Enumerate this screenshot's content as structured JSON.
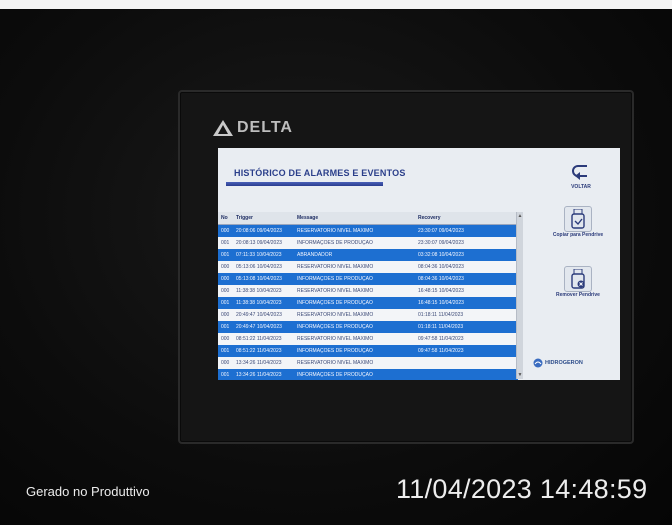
{
  "device": {
    "brand": "DELTA"
  },
  "screen": {
    "title": "HISTÓRICO DE ALARMES E EVENTOS",
    "table": {
      "headers": [
        "No",
        "Trigger",
        "Message",
        "Recovery"
      ],
      "rows": [
        {
          "no": "000",
          "trigger": "20:08:06 09/04/2023",
          "message": "RESERVATÓRIO NÍVEL MÁXIMO",
          "recovery": "23:30:07 09/04/2023",
          "style": "blue"
        },
        {
          "no": "001",
          "trigger": "20:08:13 09/04/2023",
          "message": "INFORMAÇÕES DE PRODUÇÃO",
          "recovery": "23:30:07 09/04/2023",
          "style": "white"
        },
        {
          "no": "001",
          "trigger": "07:11:33 10/04/2023",
          "message": "ABRANDADOR",
          "recovery": "03:32:08 10/04/2023",
          "style": "blue"
        },
        {
          "no": "000",
          "trigger": "05:13:06 10/04/2023",
          "message": "RESERVATÓRIO NÍVEL MÁXIMO",
          "recovery": "08:04:36 10/04/2023",
          "style": "white"
        },
        {
          "no": "000",
          "trigger": "05:13:08 10/04/2023",
          "message": "INFORMAÇÕES DE PRODUÇÃO",
          "recovery": "08:04:36 10/04/2023",
          "style": "blue"
        },
        {
          "no": "000",
          "trigger": "11:38:38 10/04/2023",
          "message": "RESERVATÓRIO NÍVEL MÁXIMO",
          "recovery": "16:48:15 10/04/2023",
          "style": "white"
        },
        {
          "no": "001",
          "trigger": "11:38:38 10/04/2023",
          "message": "INFORMAÇÕES DE PRODUÇÃO",
          "recovery": "16:48:15 10/04/2023",
          "style": "blue"
        },
        {
          "no": "000",
          "trigger": "20:49:47 10/04/2023",
          "message": "RESERVATÓRIO NÍVEL MÁXIMO",
          "recovery": "01:18:11 11/04/2023",
          "style": "white"
        },
        {
          "no": "001",
          "trigger": "20:49:47 10/04/2023",
          "message": "INFORMAÇÕES DE PRODUÇÃO",
          "recovery": "01:18:11 11/04/2023",
          "style": "blue"
        },
        {
          "no": "000",
          "trigger": "08:51:22 11/04/2023",
          "message": "RESERVATÓRIO NÍVEL MÁXIMO",
          "recovery": "09:47:58 11/04/2023",
          "style": "white"
        },
        {
          "no": "001",
          "trigger": "08:51:22 11/04/2023",
          "message": "INFORMAÇÕES DE PRODUÇÃO",
          "recovery": "09:47:58 11/04/2023",
          "style": "blue"
        },
        {
          "no": "000",
          "trigger": "13:34:26 11/04/2023",
          "message": "RESERVATÓRIO NÍVEL MÁXIMO",
          "recovery": "",
          "style": "white"
        },
        {
          "no": "001",
          "trigger": "13:34:26 11/04/2023",
          "message": "INFORMAÇÕES DE PRODUÇÃO",
          "recovery": "",
          "style": "blue"
        }
      ]
    },
    "buttons": {
      "back": "VOLTAR",
      "copy": "Copiar para Pendrive",
      "remove": "Remover Pendrive"
    },
    "company_logo": "HIDROGERON"
  },
  "caption": {
    "left": "Gerado no Produttivo",
    "timestamp": "11/04/2023 14:48:59"
  },
  "colors": {
    "row_blue": "#1d6fd1",
    "title_blue": "#2a3e8a"
  },
  "icons": [
    "delta-logo-icon",
    "back-arrow-icon",
    "usb-copy-icon",
    "usb-remove-icon",
    "scroll-up-icon",
    "scroll-down-icon"
  ]
}
